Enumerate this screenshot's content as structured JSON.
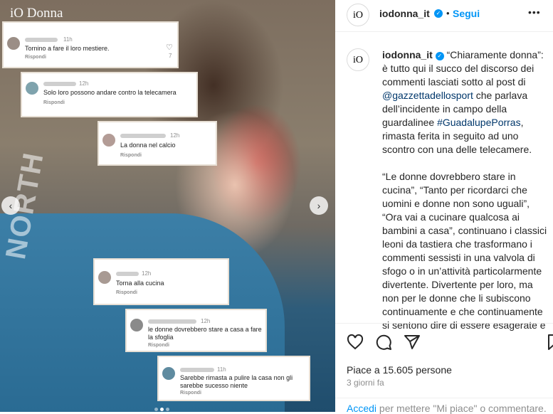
{
  "image": {
    "logo": "iO Donna",
    "jersey_text": "NORTH",
    "comments": [
      {
        "time": "11h",
        "text": "Tornino a fare il loro mestiere.",
        "reply": "Rispondi",
        "likes": "7"
      },
      {
        "time": "12h",
        "text": "Solo loro possono andare contro la telecamera",
        "reply": "Rispondi"
      },
      {
        "time": "12h",
        "text": "La donna nel calcio",
        "reply": "Rispondi"
      },
      {
        "time": "12h",
        "text": "Torna alla cucina",
        "reply": "Rispondi"
      },
      {
        "time": "12h",
        "text": "le donne dovrebbero stare a casa  a  fare la sfoglia",
        "reply": "Rispondi"
      },
      {
        "time": "11h",
        "text": "Sarebbe rimasta a pulire la casa non gli sarebbe sucesso niente",
        "reply": "Rispondi"
      }
    ],
    "prev_icon": "chevron-left-icon",
    "next_icon": "chevron-right-icon"
  },
  "header": {
    "avatar": "iO",
    "username": "iodonna_it",
    "verified_icon": "verified-badge-icon",
    "separator": "•",
    "follow": "Segui",
    "more": "•••"
  },
  "caption": {
    "avatar": "iO",
    "username": "iodonna_it",
    "p1_a": "“Chiaramente donna”: è tutto qui il succo del discorso dei commenti lasciati sotto al post di ",
    "mention": "@gazzettadellosport",
    "p1_b": " che parlava dell’incidente in campo della guardalinee ",
    "hashtag": "#GuadalupePorras",
    "p1_c": ", rimasta ferita in seguito ad uno scontro con una delle telecamere.",
    "p2": "“Le donne dovrebbero stare in cucina”, “Tanto per ricordarci che uomini e donne non sono uguali”, “Ora vai a cucinare qualcosa ai bambini a casa”, continuano i classici leoni da tastiera che trasformano i commenti sessisti in una valvola di sfogo o in un’attività particolarmente divertente. Divertente per loro, ma non per le donne che li subiscono continuamente e che continuamente si sentono dire di essere esagerate e"
  },
  "actions": {
    "like_icon": "heart-icon",
    "comment_icon": "comment-icon",
    "share_icon": "share-icon",
    "save_icon": "bookmark-icon",
    "likes": "Piace a 15.605 persone",
    "date": "3 giorni fa"
  },
  "login": {
    "link": "Accedi",
    "text": " per mettere \"Mi piace\" o commentare."
  }
}
